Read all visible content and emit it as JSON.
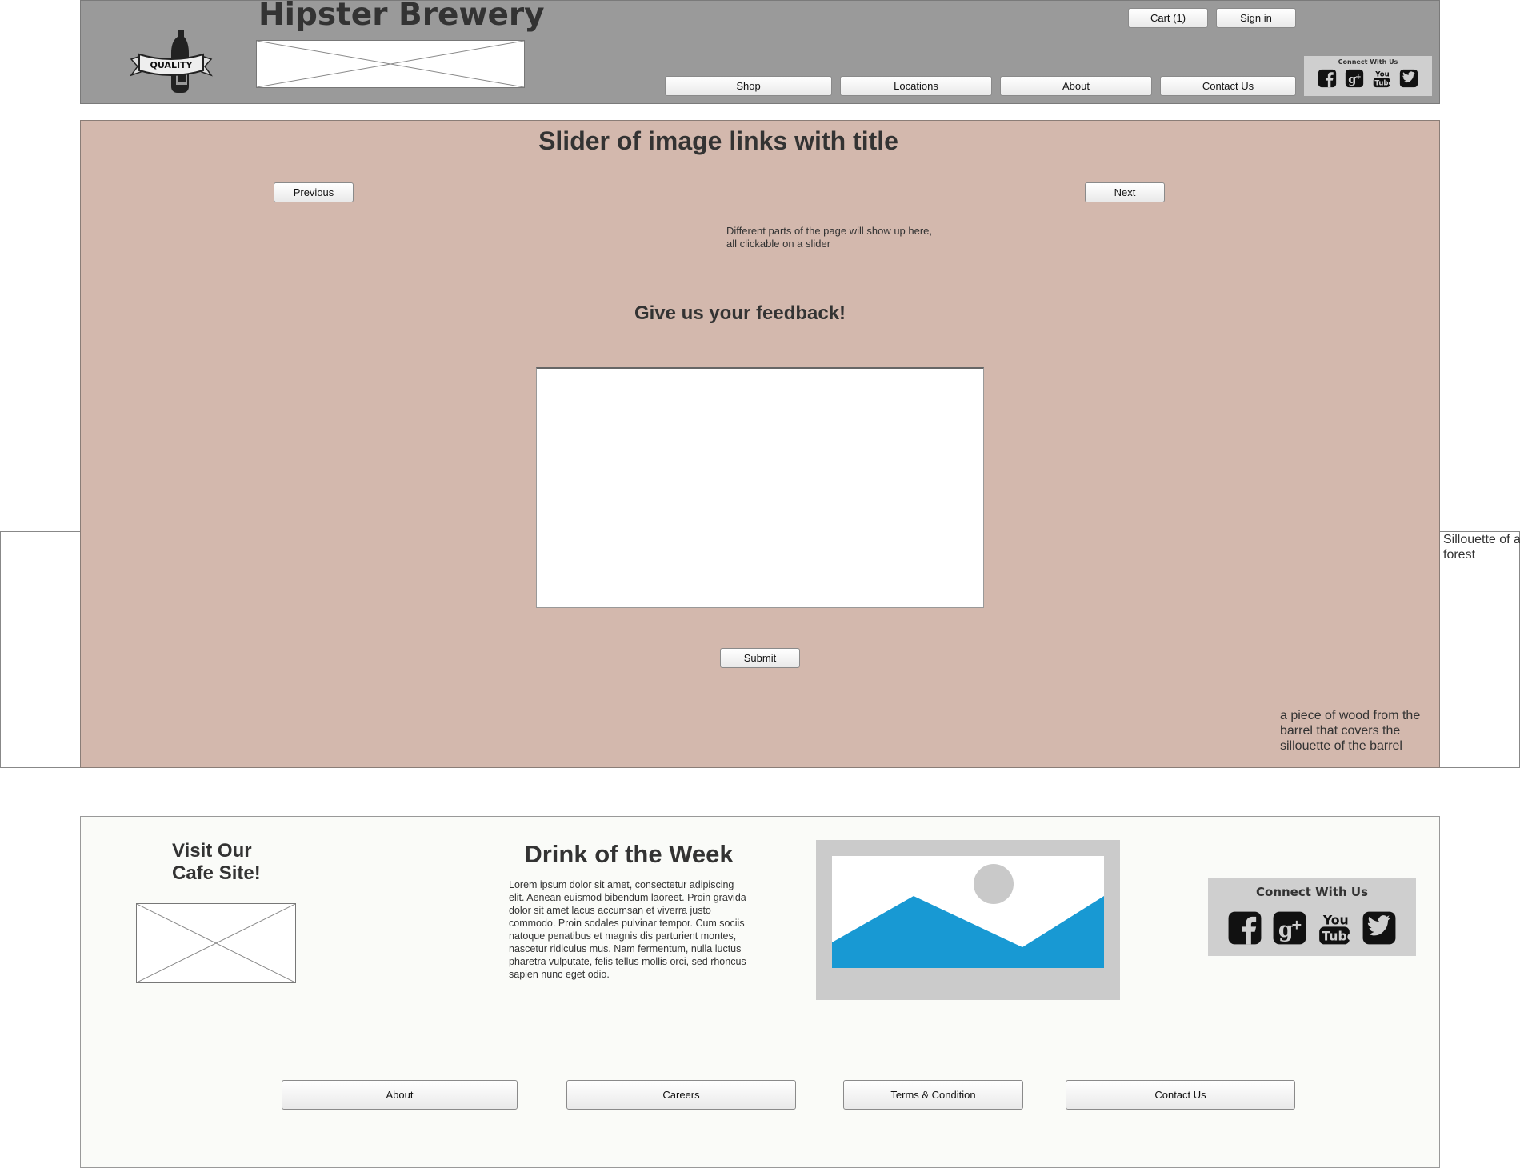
{
  "header": {
    "brand_title": "Hipster Brewery",
    "logo_text": "QUALITY",
    "cart_label": "Cart (1)",
    "signin_label": "Sign in",
    "nav": [
      {
        "label": "Shop"
      },
      {
        "label": "Locations"
      },
      {
        "label": "About"
      },
      {
        "label": "Contact Us"
      }
    ],
    "social_title": "Connect With Us",
    "social_icons": [
      "facebook-icon",
      "google-plus-icon",
      "youtube-icon",
      "twitter-icon"
    ]
  },
  "slider": {
    "title": "Slider of image links with title",
    "prev_label": "Previous",
    "next_label": "Next",
    "note_line1": "Different parts of the page will show up here,",
    "note_line2": "all clickable on a slider"
  },
  "feedback": {
    "title": "Give us your feedback!",
    "textarea_value": "",
    "submit_label": "Submit"
  },
  "side_notes": {
    "right_note_line1": "Sillouette of a",
    "right_note_line2": "forest",
    "wood_note_line1": "a piece of wood from the",
    "wood_note_line2": "barrel that covers the",
    "wood_note_line3": "sillouette of the barrel"
  },
  "footer": {
    "visit_line1": "Visit Our",
    "visit_line2": "Cafe Site!",
    "drink_title": "Drink of the Week",
    "drink_text": "Lorem ipsum dolor sit amet, consectetur adipiscing elit. Aenean euismod bibendum laoreet. Proin gravida dolor sit amet lacus accumsan et viverra justo commodo. Proin sodales pulvinar tempor. Cum sociis natoque penatibus et magnis dis parturient montes, nascetur ridiculus mus. Nam fermentum, nulla luctus pharetra vulputate, felis tellus mollis orci, sed rhoncus sapien nunc eget odio.",
    "social_title": "Connect With Us",
    "links": [
      {
        "label": "About"
      },
      {
        "label": "Careers"
      },
      {
        "label": "Terms & Condition"
      },
      {
        "label": "Contact Us"
      }
    ]
  },
  "colors": {
    "header_bg": "#9a9a9a",
    "main_bg": "#d3b8ad",
    "footer_bg": "#fafbf8",
    "image_accent": "#1899d3"
  }
}
